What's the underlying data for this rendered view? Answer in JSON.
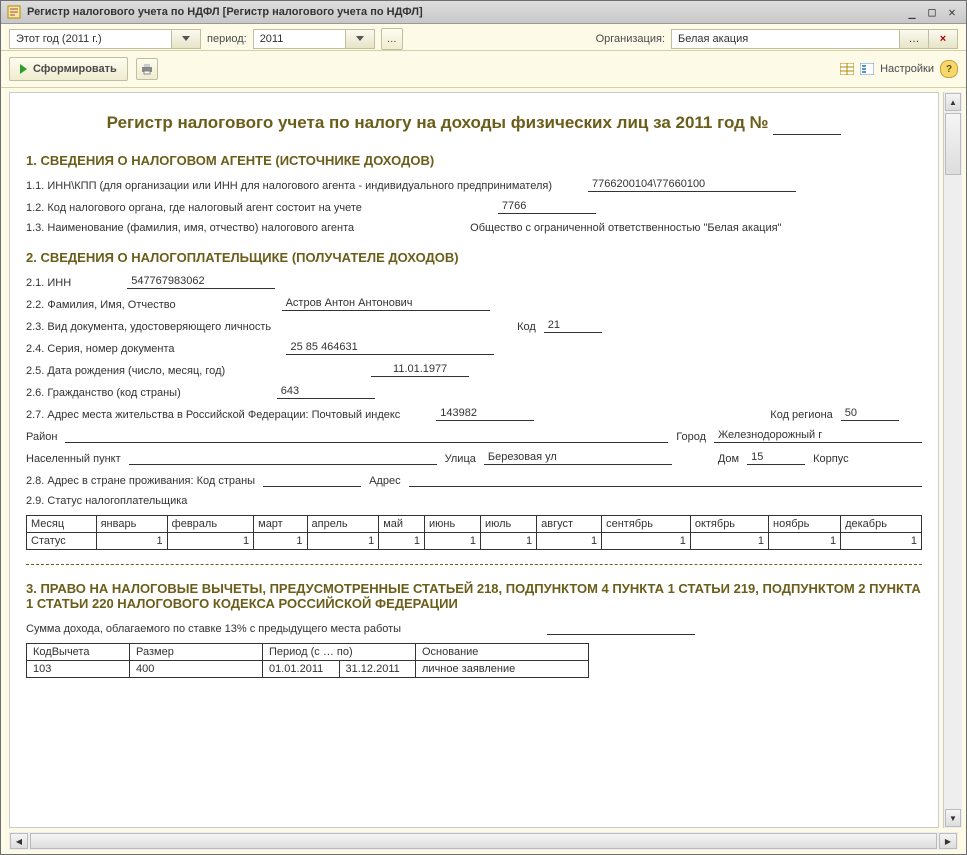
{
  "window": {
    "title": "Регистр налогового учета по НДФЛ [Регистр налогового учета по НДФЛ]"
  },
  "toolbar": {
    "year_selector": "Этот год (2011 г.)",
    "period_label": "период:",
    "period_value": "2011",
    "org_label": "Организация:",
    "org_value": "Белая акация",
    "form_btn": "Сформировать",
    "settings_link": "Настройки"
  },
  "doc": {
    "title": "Регистр налогового учета по налогу на доходы физических лиц за 2011 год №",
    "section1": {
      "heading": "1. СВЕДЕНИЯ О НАЛОГОВОМ АГЕНТЕ (ИСТОЧНИКЕ ДОХОДОВ)",
      "r11_label": "1.1.  ИНН\\КПП (для организации или ИНН для налогового агента -  индивидуального предпринимателя)",
      "r11_value": "7766200104\\77660100",
      "r12_label": "1.2.  Код налогового органа, где налоговый агент состоит на учете",
      "r12_value": "7766",
      "r13_label": "1.3.  Наименование (фамилия, имя, отчество) налогового агента",
      "r13_value": "Общество с ограниченной ответственностью \"Белая акация\""
    },
    "section2": {
      "heading": "2. СВЕДЕНИЯ О НАЛОГОПЛАТЕЛЬЩИКЕ (ПОЛУЧАТЕЛЕ ДОХОДОВ)",
      "r21_label": "2.1.  ИНН",
      "r21_value": "547767983062",
      "r22_label": "2.2.  Фамилия, Имя, Отчество",
      "r22_value": "Астров Антон Антонович",
      "r23_label": "2.3.  Вид документа, удостоверяющего личность",
      "r23_code_label": "Код",
      "r23_code": "21",
      "r24_label": "2.4.  Серия, номер документа",
      "r24_value": "25 85 464631",
      "r25_label": "2.5. Дата рождения (число, месяц, год)",
      "r25_value": "11.01.1977",
      "r26_label": "2.6. Гражданство (код страны)",
      "r26_value": "643",
      "r27_label": "2.7.  Адрес места жительства в Российской Федерации:  Почтовый индекс",
      "r27_index": "143982",
      "r27_region_label": "Код региона",
      "r27_region": "50",
      "district_label": "Район",
      "city_label": "Город",
      "city": "Железнодорожный г",
      "locality_label": "Населенный пункт",
      "street_label": "Улица",
      "street": "Березовая ул",
      "house_label": "Дом",
      "house": "15",
      "building_label": "Корпус",
      "r28_label": "2.8.  Адрес в стране проживания: Код страны",
      "r28_addr_label": "Адрес",
      "r29_label": "2.9.  Статус налогоплательщика",
      "months": [
        "Месяц",
        "январь",
        "февраль",
        "март",
        "апрель",
        "май",
        "июнь",
        "июль",
        "август",
        "сентябрь",
        "октябрь",
        "ноябрь",
        "декабрь"
      ],
      "status_row_label": "Статус",
      "status_values": [
        "1",
        "1",
        "1",
        "1",
        "1",
        "1",
        "1",
        "1",
        "1",
        "1",
        "1",
        "1"
      ]
    },
    "section3": {
      "heading": "3. ПРАВО НА НАЛОГОВЫЕ ВЫЧЕТЫ, ПРЕДУСМОТРЕННЫЕ СТАТЬЕЙ  218, ПОДПУНКТОМ 4 ПУНКТА 1 СТАТЬИ 219, ПОДПУНКТОМ 2 ПУНКТА 1 СТАТЬИ 220 НАЛОГОВОГО КОДЕКСА РОССИЙСКОЙ ФЕДЕРАЦИИ",
      "prev_income_label": "Сумма дохода, облагаемого по ставке 13% с предыдущего места работы",
      "ded_headers": [
        "КодВычета",
        "Размер",
        "Период (с … по)",
        "",
        "Основание"
      ],
      "ded_row": {
        "code": "103",
        "size": "400",
        "from": "01.01.2011",
        "to": "31.12.2011",
        "basis": "личное заявление"
      }
    }
  }
}
